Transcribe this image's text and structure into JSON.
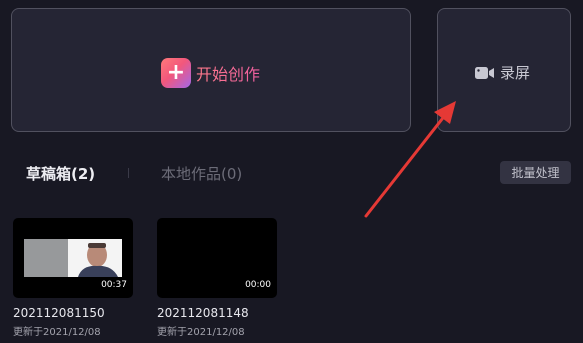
{
  "create": {
    "label": "开始创作",
    "icon": "plus-icon"
  },
  "record": {
    "label": "录屏",
    "icon": "video-camera-icon"
  },
  "tabs": [
    {
      "label": "草稿箱(2)"
    },
    {
      "label": "本地作品(0)"
    }
  ],
  "batch_button": "批量处理",
  "drafts": [
    {
      "title": "202112081150",
      "updated": "更新于2021/12/08",
      "duration": "00:37"
    },
    {
      "title": "202112081148",
      "updated": "更新于2021/12/08",
      "duration": "00:00"
    }
  ],
  "colors": {
    "background": "#181823",
    "card": "#252534",
    "accent_pink": "#f2577c",
    "annotation_arrow": "#e53935"
  }
}
